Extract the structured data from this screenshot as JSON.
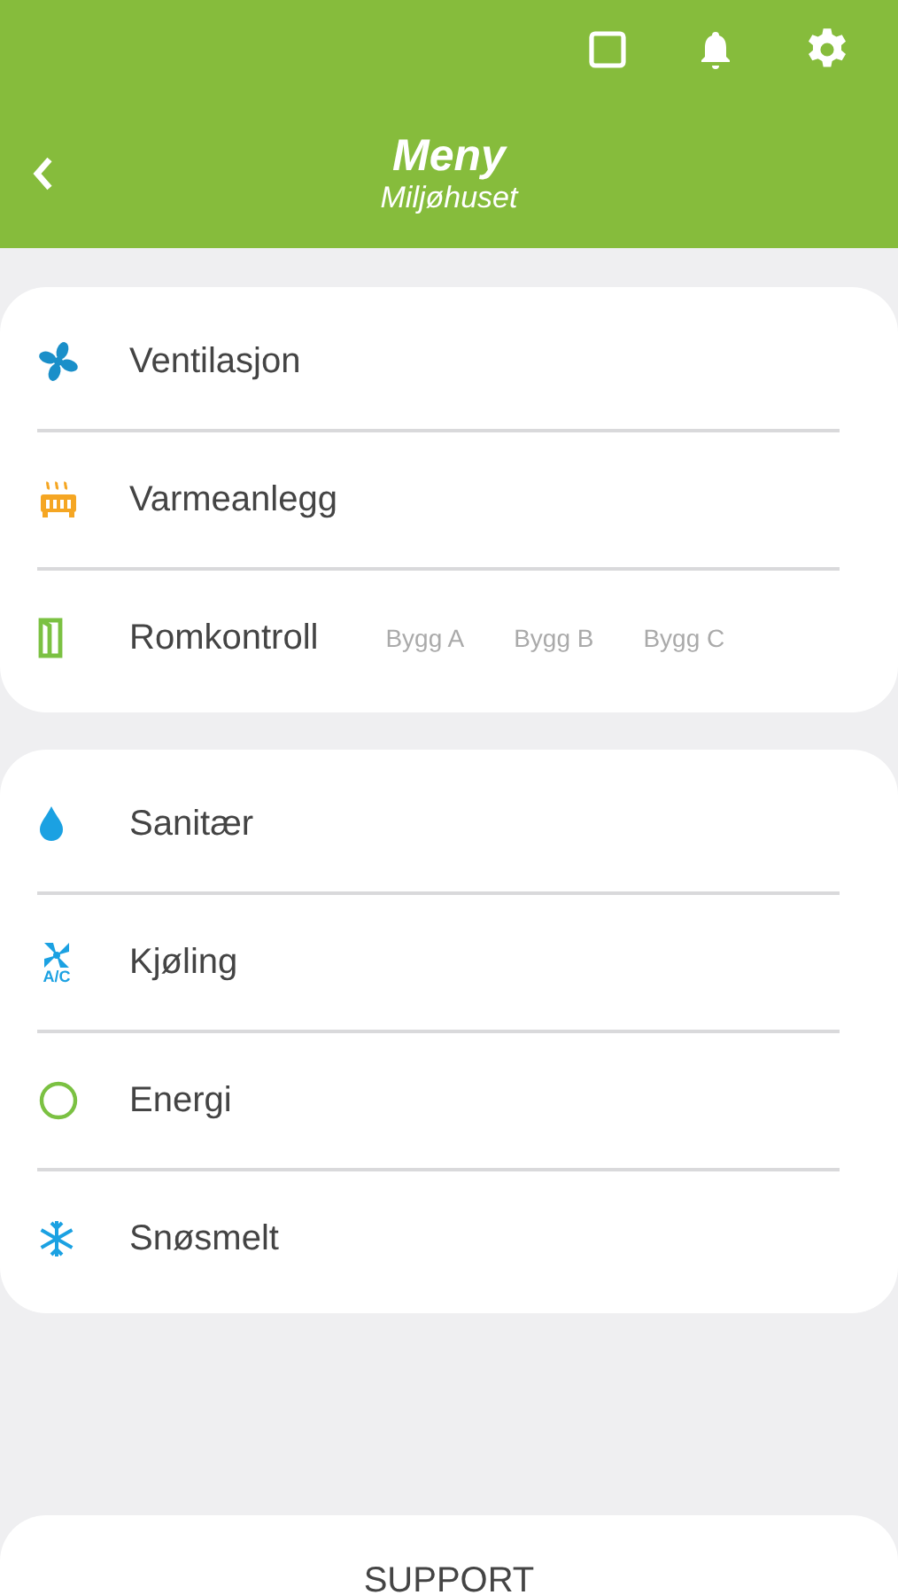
{
  "header": {
    "title": "Meny",
    "subtitle": "Miljøhuset"
  },
  "groups": [
    {
      "items": [
        {
          "kind": "fan",
          "label": "Ventilasjon"
        },
        {
          "kind": "radiator",
          "label": "Varmeanlegg"
        },
        {
          "kind": "door",
          "label": "Romkontroll",
          "links": [
            "Bygg A",
            "Bygg B",
            "Bygg C"
          ]
        }
      ]
    },
    {
      "items": [
        {
          "kind": "drop",
          "label": "Sanitær"
        },
        {
          "kind": "ac",
          "label": "Kjøling",
          "icon_text": "A/C"
        },
        {
          "kind": "ring",
          "label": "Energi"
        },
        {
          "kind": "snow",
          "label": "Snøsmelt"
        }
      ]
    }
  ],
  "support": {
    "label": "SUPPORT"
  }
}
